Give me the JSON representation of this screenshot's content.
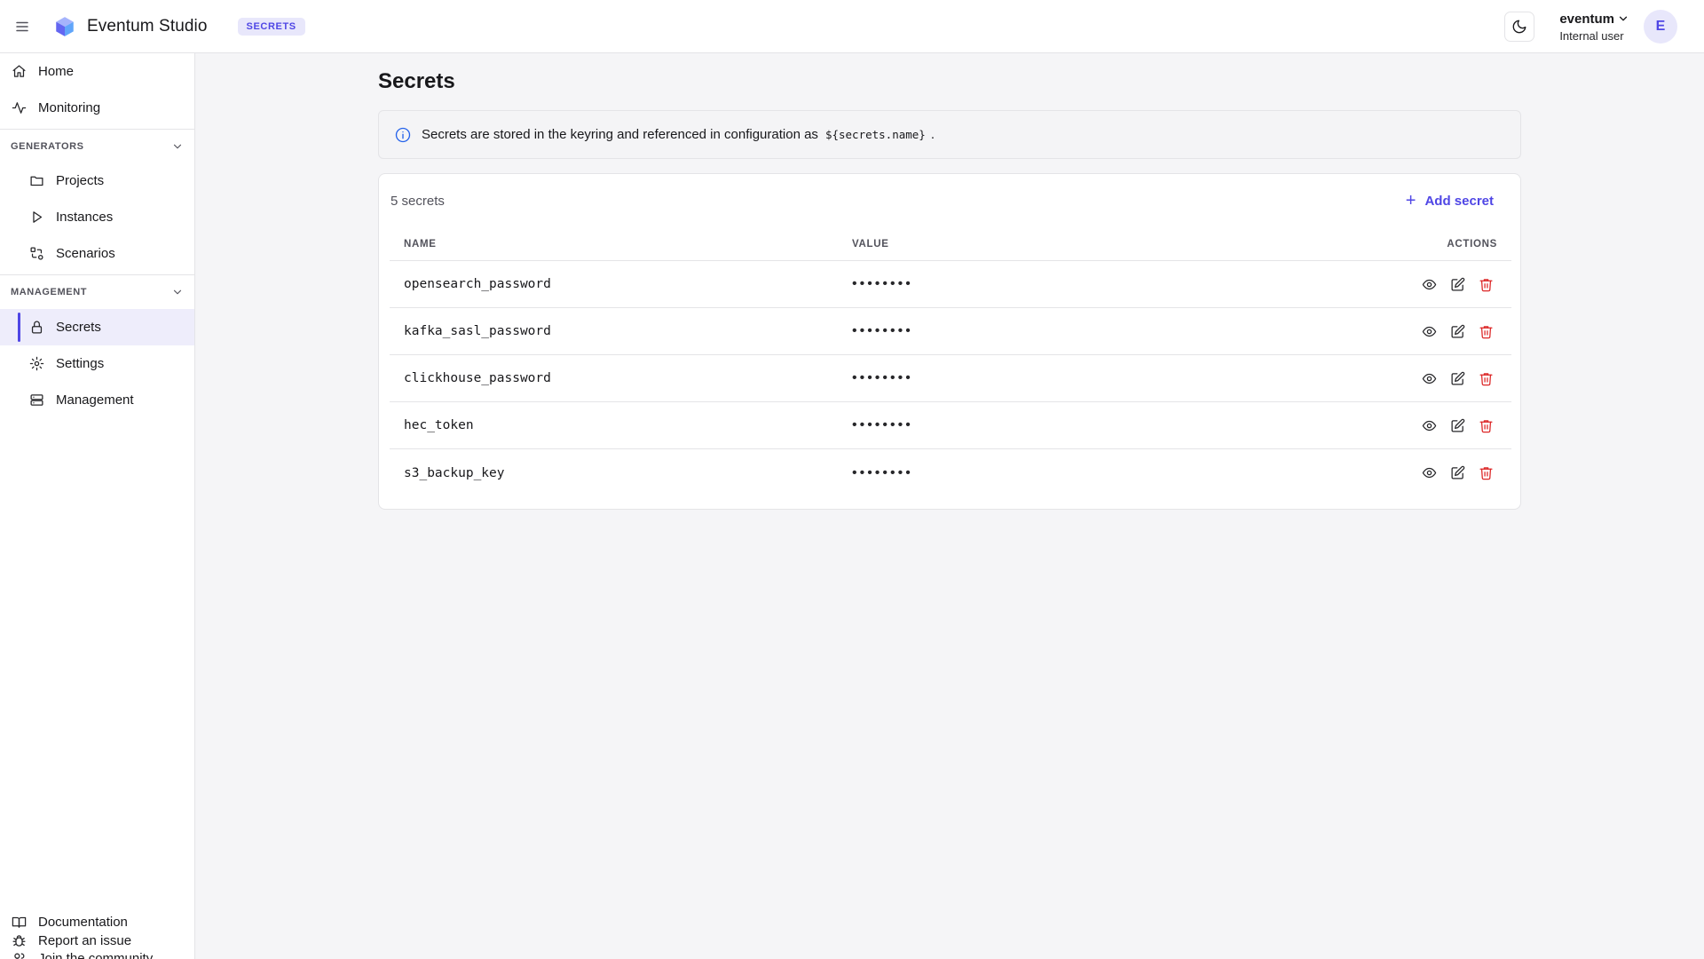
{
  "header": {
    "app_title": "Eventum Studio",
    "section_badge": "SECRETS",
    "user_name": "eventum",
    "user_role": "Internal user",
    "avatar_initial": "E",
    "icons": {
      "menu": "menu-icon",
      "logo": "cube-logo",
      "theme": "moon-icon",
      "user_menu": "chevron-down-icon"
    }
  },
  "sidebar": {
    "top_items": [
      {
        "label": "Home",
        "icon": "home-icon"
      },
      {
        "label": "Monitoring",
        "icon": "activity-icon"
      }
    ],
    "groups": [
      {
        "title": "GENERATORS",
        "items": [
          {
            "label": "Projects",
            "icon": "folder-icon"
          },
          {
            "label": "Instances",
            "icon": "play-icon"
          },
          {
            "label": "Scenarios",
            "icon": "route-icon"
          }
        ]
      },
      {
        "title": "MANAGEMENT",
        "items": [
          {
            "label": "Secrets",
            "icon": "lock-icon",
            "active": true
          },
          {
            "label": "Settings",
            "icon": "gear-icon"
          },
          {
            "label": "Management",
            "icon": "server-icon"
          }
        ]
      }
    ],
    "bottom_items": [
      {
        "label": "Documentation",
        "icon": "book-icon"
      },
      {
        "label": "Join the community",
        "icon": "users-icon"
      },
      {
        "label": "Report an issue",
        "icon": "bug-icon"
      }
    ]
  },
  "main": {
    "title": "Secrets",
    "info": {
      "text": "Secrets are stored in the keyring and referenced in configuration as",
      "code": "${secrets.name}",
      "suffix": "."
    },
    "card": {
      "count_label": "5 secrets",
      "add_label": "Add secret",
      "columns": {
        "name": "NAME",
        "value": "VALUE",
        "actions": "ACTIONS"
      },
      "rows": [
        {
          "name": "opensearch_password",
          "value": "••••••••"
        },
        {
          "name": "kafka_sasl_password",
          "value": "••••••••"
        },
        {
          "name": "clickhouse_password",
          "value": "••••••••"
        },
        {
          "name": "hec_token",
          "value": "••••••••"
        },
        {
          "name": "s3_backup_key",
          "value": "••••••••"
        }
      ]
    }
  },
  "colors": {
    "accent": "#4f46e5",
    "danger": "#dc2626",
    "badge_bg": "#e8e7fb"
  }
}
